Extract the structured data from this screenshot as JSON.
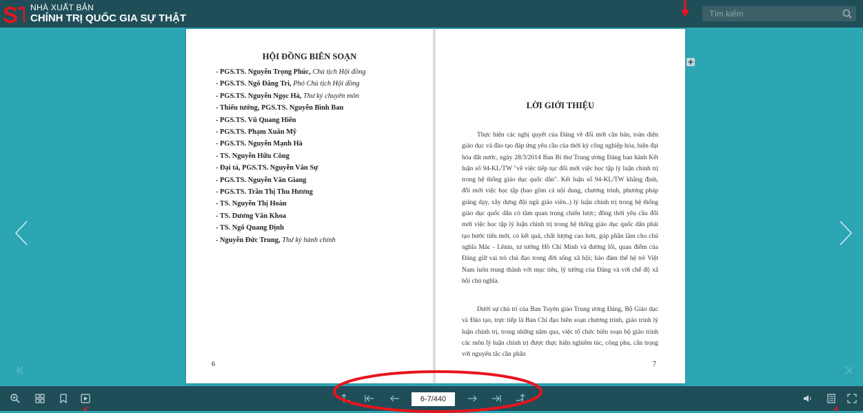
{
  "publisher": {
    "logo_text": "ST",
    "line1": "NHÀ XUẤT BẢN",
    "line2": "CHÍNH TRỊ QUỐC GIA SỰ THẬT"
  },
  "search": {
    "placeholder": "Tìm kiếm"
  },
  "left_page": {
    "title": "HỘI ĐỒNG BIÊN SOẠN",
    "members": [
      {
        "name": "- PGS.TS. Nguyễn Trọng Phúc,",
        "role": " Chủ tịch Hội đồng"
      },
      {
        "name": "- PGS.TS. Ngô Đăng Tri,",
        "role": " Phó Chủ tịch Hội đồng"
      },
      {
        "name": "- PGS.TS. Nguyễn Ngọc Hà,",
        "role": " Thư ký chuyên môn"
      },
      {
        "name": "- Thiếu tướng, PGS.TS. Nguyễn Bình Ban",
        "role": ""
      },
      {
        "name": "- PGS.TS. Vũ Quang Hiển",
        "role": ""
      },
      {
        "name": "- PGS.TS. Phạm Xuân Mỹ",
        "role": ""
      },
      {
        "name": "- PGS.TS. Nguyễn Mạnh Hà",
        "role": ""
      },
      {
        "name": "- TS. Nguyễn Hữu Công",
        "role": ""
      },
      {
        "name": "- Đại tá, PGS.TS. Nguyễn Văn Sự",
        "role": ""
      },
      {
        "name": "- PGS.TS. Nguyễn Văn Giang",
        "role": ""
      },
      {
        "name": "- PGS.TS. Trần Thị Thu Hương",
        "role": ""
      },
      {
        "name": "- TS. Nguyễn Thị Hoàn",
        "role": ""
      },
      {
        "name": "- TS. Dương Văn Khoa",
        "role": ""
      },
      {
        "name": "- TS. Ngô Quang Định",
        "role": ""
      },
      {
        "name": "- Nguyễn Đức Trung,",
        "role": " Thư ký hành chính"
      }
    ],
    "page_number": "6"
  },
  "right_page": {
    "title": "LỜI GIỚI THIỆU",
    "para1": "Thực hiện các nghị quyết của Đảng về đổi mới căn bản, toàn diện giáo dục và đào tạo đáp ứng yêu cầu của thời kỳ công nghiệp hóa, hiện đại hóa đất nước, ngày 28/3/2014 Ban Bí thư Trung ương Đảng ban hành Kết luận số 94-KL/TW \"về việc tiếp tục đổi mới việc học tập lý luận chính trị trong hệ thống giáo dục quốc dân\". Kết luận số 94-KL/TW khẳng định, đổi mới việc học tập (bao gồm cả nội dung, chương trình, phương pháp giảng dạy, xây dựng đội ngũ giáo viên..) lý luận chính trị trong hệ thống giáo dục quốc dân có tầm quan trọng chiến lược; đồng thời yêu cầu đổi mới việc học tập lý luận chính trị trong hệ thống giáo dục quốc dân phải tạo bước tiến mới, có kết quả, chất lượng cao hơn, góp phần làm cho chủ nghĩa Mác - Lênin, tư tưởng Hồ Chí Minh và đường lối, quan điểm của Đảng giữ vai trò chủ đạo trong đời sống xã hội; bảo đảm thế hệ trẻ Việt Nam luôn trung thành với mục tiêu, lý tưởng của Đảng và với chế độ xã hội chủ nghĩa.",
    "para2": "Dưới sự chủ trì của Ban Tuyên giáo Trung ương Đảng, Bộ Giáo dục và Đào tạo, trực tiếp là Ban Chỉ đạo biên soạn chương trình, giáo trình lý luận chính trị, trong những năm qua, việc tổ chức biên soạn bộ giáo trình các môn lý luận chính trị được thực hiện nghiêm túc, công phu, cẩn trọng với nguyên tắc cần phân",
    "page_number": "7"
  },
  "pager": {
    "value": "6-7/440"
  },
  "colors": {
    "bar": "#1f4e59",
    "stage": "#2da6b4",
    "annotation": "#e8141b"
  }
}
